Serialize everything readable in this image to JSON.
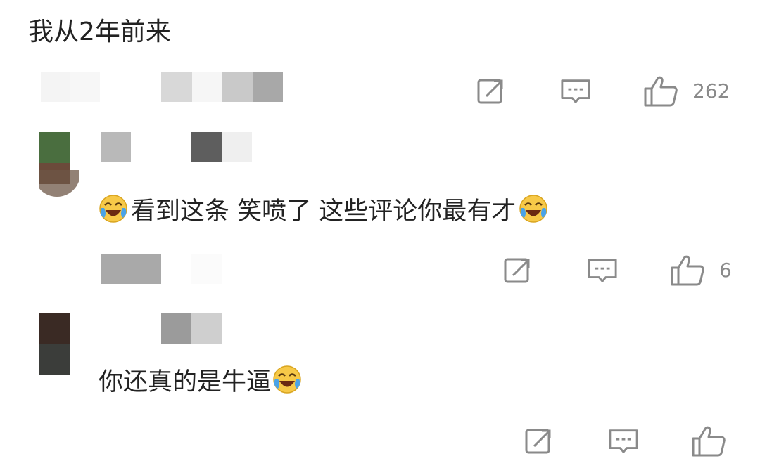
{
  "comments": [
    {
      "text": "我从2年前来",
      "actions": {
        "reply_label": "reply-icon",
        "comment_label": "comment-icon",
        "like_label": "thumbs-up-icon",
        "like_count": "262"
      }
    },
    {
      "text_before": "看到这条 笑喷了 这些评论你最有才",
      "emoji": "crying-laughing-emoji",
      "actions": {
        "reply_label": "reply-icon",
        "comment_label": "comment-icon",
        "like_label": "thumbs-up-icon",
        "like_count": "6"
      }
    },
    {
      "text_before": "你还真的是牛逼",
      "emoji": "crying-laughing-emoji",
      "actions": {
        "reply_label": "reply-icon",
        "comment_label": "comment-icon",
        "like_label": "thumbs-up-icon",
        "like_count": ""
      }
    }
  ],
  "colors": {
    "icon_gray": "#8a8a8a",
    "text": "#222222",
    "emoji_face": "#f7c948",
    "emoji_tear": "#4aa3e8"
  }
}
